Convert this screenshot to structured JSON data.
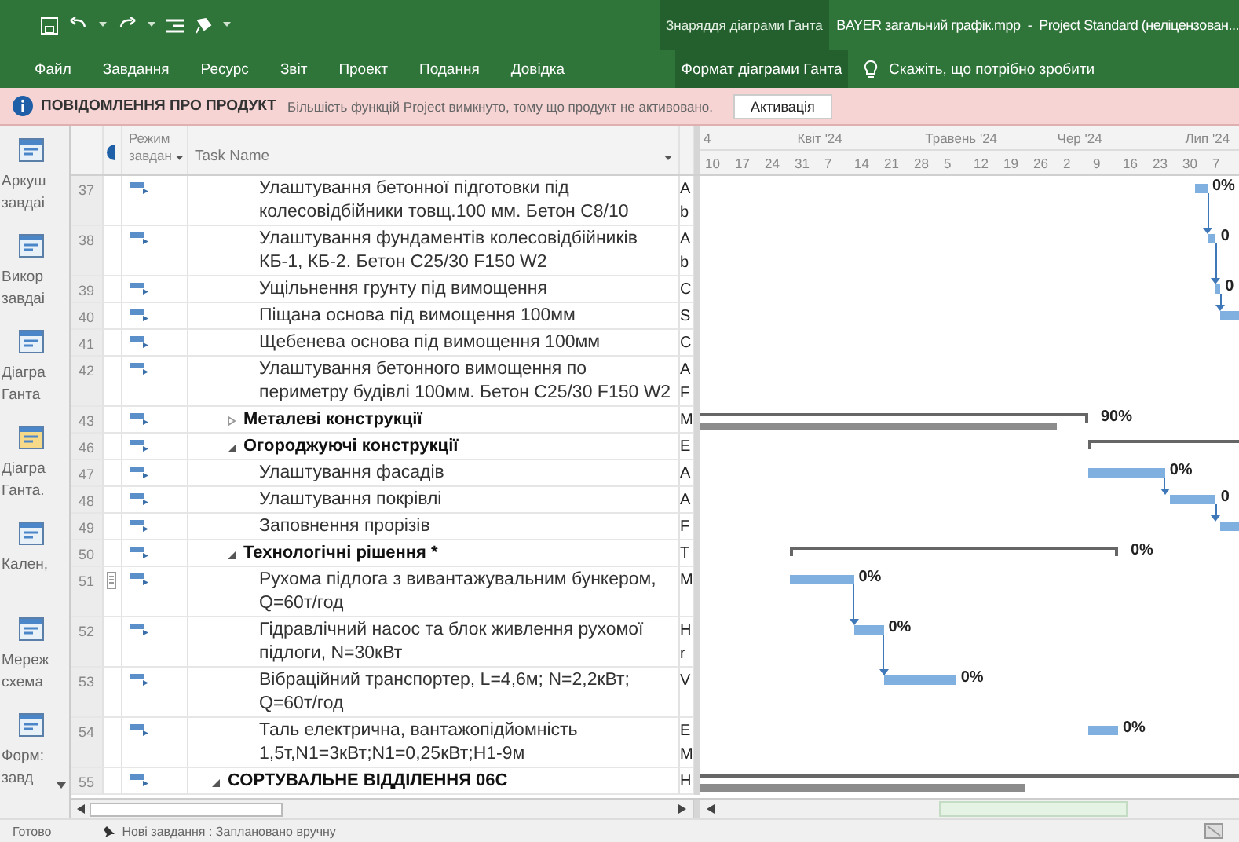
{
  "window": {
    "context_group": "Знаряддя діаграми Ганта",
    "title": "BAYER загальний графік.mpp  -  Project Standard (неліцензован..."
  },
  "ribbon_tabs": [
    {
      "label": "Файл",
      "kind": "normal"
    },
    {
      "label": "Завдання",
      "kind": "normal"
    },
    {
      "label": "Ресурс",
      "kind": "normal"
    },
    {
      "label": "Звіт",
      "kind": "normal"
    },
    {
      "label": "Проект",
      "kind": "normal"
    },
    {
      "label": "Подання",
      "kind": "normal"
    },
    {
      "label": "Довідка",
      "kind": "normal"
    },
    {
      "label": "Формат діаграми Ганта",
      "kind": "contextual"
    }
  ],
  "tell_me": {
    "placeholder": "Скажіть, що потрібно зробити"
  },
  "message_bar": {
    "title": "ПОВІДОМЛЕННЯ ПРО ПРОДУКТ",
    "text": "Більшість функцій Project вимкнуто, тому що продукт не активовано.",
    "button": "Активація"
  },
  "view_bar": [
    {
      "lines": [
        "Аркуш",
        "завдаі"
      ],
      "selected": false
    },
    {
      "lines": [
        "Викор",
        "завдаі"
      ],
      "selected": false
    },
    {
      "lines": [
        "Діагра",
        "Ганта"
      ],
      "selected": false
    },
    {
      "lines": [
        "Діагра",
        "Ганта."
      ],
      "selected": true
    },
    {
      "lines": [
        "Кален,"
      ],
      "selected": false
    },
    {
      "lines": [
        "Мереж",
        "схема"
      ],
      "selected": false
    },
    {
      "lines": [
        "Форм:",
        "завд"
      ],
      "selected": false
    }
  ],
  "table": {
    "columns": {
      "mode": "Режим завдан",
      "name": "Task Name"
    }
  },
  "timescale": {
    "months": [
      "4",
      "Квіт '24",
      "Травень '24",
      "Чер '24",
      "Лип '24"
    ],
    "weeks": [
      "10",
      "17",
      "24",
      "31",
      "7",
      "14",
      "21",
      "28",
      "5",
      "12",
      "19",
      "26",
      "2",
      "9",
      "16",
      "23",
      "30",
      "7"
    ]
  },
  "tasks": [
    {
      "kind": "continued",
      "children": [
        {
          "kind": "continued",
          "children": [
            {
              "kind": "task",
              "id": "37",
              "name": "Улаштування бетонної підготовки під колесовідбійники товщ.100 мм. Бетон С8/10",
              "column_3": [
                "A",
                "b"
              ],
              "bar": {
                "label": "0%",
                "link_to_next": true
              }
            },
            {
              "kind": "task",
              "id": "38",
              "name": "Улаштування фундаментів колесовідбійників КБ-1, КБ-2. Бетон С25/30 F150 W2",
              "column_3": [
                "A",
                "b"
              ],
              "bar": {
                "label": "0",
                "link_to_next": true
              }
            },
            {
              "kind": "task",
              "id": "39",
              "name": "Ущільнення грунту під вимощення",
              "column_3": [
                "C"
              ],
              "bar": {
                "label": "0",
                "link_to_next": true
              }
            },
            {
              "kind": "task",
              "id": "40",
              "name": "Піщана основа під вимощення 100мм",
              "column_3": [
                "S"
              ],
              "bar": {
                "link_to_next": false
              }
            },
            {
              "kind": "task",
              "id": "41",
              "name": "Щебенева основа під вимощення 100мм",
              "column_3": [
                "C"
              ]
            },
            {
              "kind": "task",
              "id": "42",
              "name": "Улаштування бетонного вимощення по периметру будівлі 100мм. Бетон С25/30 F150 W2",
              "column_3": [
                "A",
                "F"
              ]
            }
          ]
        },
        {
          "kind": "summary",
          "id": "43",
          "name": "Металеві конструкції",
          "expanded": false,
          "column_3": [
            "M"
          ],
          "bar": {
            "label": "90%",
            "level": 0.95
          }
        },
        {
          "kind": "summary",
          "id": "46",
          "name": "Огороджуючі конструкції",
          "expanded": true,
          "column_3": [
            "E"
          ],
          "children": [
            {
              "kind": "task",
              "id": "47",
              "name": "Улаштування фасадів",
              "column_3": [
                "A"
              ],
              "bar": {
                "label": "0%",
                "link_to_next": true
              }
            },
            {
              "kind": "task",
              "id": "48",
              "name": "Улаштування покрівлі",
              "column_3": [
                "A"
              ],
              "bar": {
                "label": "0",
                "link_to_next": true
              }
            },
            {
              "kind": "task",
              "id": "49",
              "name": "Заповнення прорізів",
              "column_3": [
                "F"
              ],
              "bar": {
                "link_to_next": false
              }
            }
          ]
        },
        {
          "kind": "summary",
          "id": "50",
          "name": "Технологічні рішення *",
          "expanded": true,
          "column_3": [
            "T"
          ],
          "bar": {
            "label": "0%"
          },
          "children": [
            {
              "kind": "task",
              "id": "51",
              "name": "Рухома підлога з вивантажувальним бункером, Q=60т/год",
              "note": true,
              "column_3": [
                "M"
              ],
              "bar": {
                "label": "0%",
                "link_to_next": true
              }
            },
            {
              "kind": "task",
              "id": "52",
              "name": "Гідравлічний насос та блок живлення рухомої підлоги, N=30кВт",
              "column_3": [
                "H",
                "r"
              ],
              "bar": {
                "label": "0%",
                "link_to_next": true
              }
            },
            {
              "kind": "task",
              "id": "53",
              "name": "Вібраційний транспортер, L=4,6м; N=2,2кВт; Q=60т/год",
              "column_3": [
                "V"
              ],
              "bar": {
                "label": "0%",
                "link_to_next": false
              }
            },
            {
              "kind": "task",
              "id": "54",
              "name": "Таль електрична, вантажопідйомність 1,5т,N1=3кВт;N1=0,25кВт;H1-9м",
              "column_3": [
                "E",
                "M"
              ],
              "bar": {
                "label": "0%",
                "link_to_next": false
              }
            }
          ]
        }
      ]
    },
    {
      "kind": "summary",
      "id": "55",
      "name": "СОРТУВАЛЬНЕ ВІДДІЛЕННЯ 06С",
      "expanded": true,
      "column_3": [
        "H"
      ],
      "bar": {
        "level": 0.58
      }
    }
  ],
  "status_bar": {
    "ready": "Готово",
    "new_tasks": "Нові завдання : Заплановано вручну"
  }
}
